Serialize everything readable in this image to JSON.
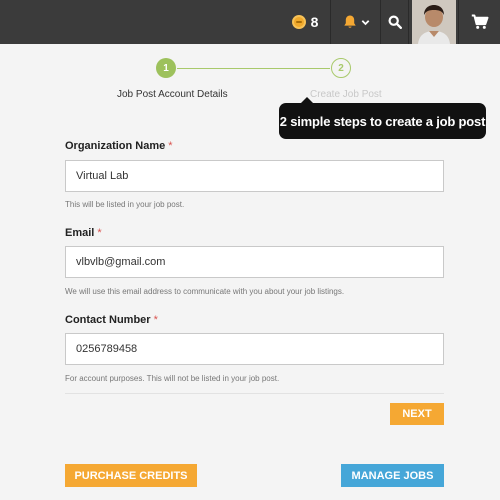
{
  "header": {
    "credit_count": "8",
    "icons": [
      "coin-icon",
      "bell-icon",
      "chevron-down-icon",
      "search-icon",
      "avatar",
      "cart-icon"
    ]
  },
  "stepper": {
    "steps": [
      {
        "number": "1",
        "label": "Job Post Account Details",
        "state": "active"
      },
      {
        "number": "2",
        "label": "Create Job Post",
        "state": "inactive"
      }
    ]
  },
  "tooltip": {
    "text": "2 simple steps to create a job post"
  },
  "form": {
    "organization": {
      "label": "Organization Name",
      "required_mark": "*",
      "value": "Virtual Lab",
      "help": "This will be listed in your job post."
    },
    "email": {
      "label": "Email",
      "required_mark": "*",
      "value": "vlbvlb@gmail.com",
      "help": "We will use this email address to communicate with you about your job listings."
    },
    "contact": {
      "label": "Contact Number",
      "required_mark": "*",
      "value": "0256789458",
      "help": "For account purposes. This will not be listed in your job post."
    },
    "next_label": "NEXT"
  },
  "footer": {
    "purchase_label": "PURCHASE CREDITS",
    "manage_label": "MANAGE JOBS"
  },
  "colors": {
    "topbar": "#3b3b3b",
    "accent_orange": "#f5a833",
    "accent_blue": "#45a6d8",
    "step_green": "#9dc15c",
    "tooltip_bg": "#111111"
  }
}
